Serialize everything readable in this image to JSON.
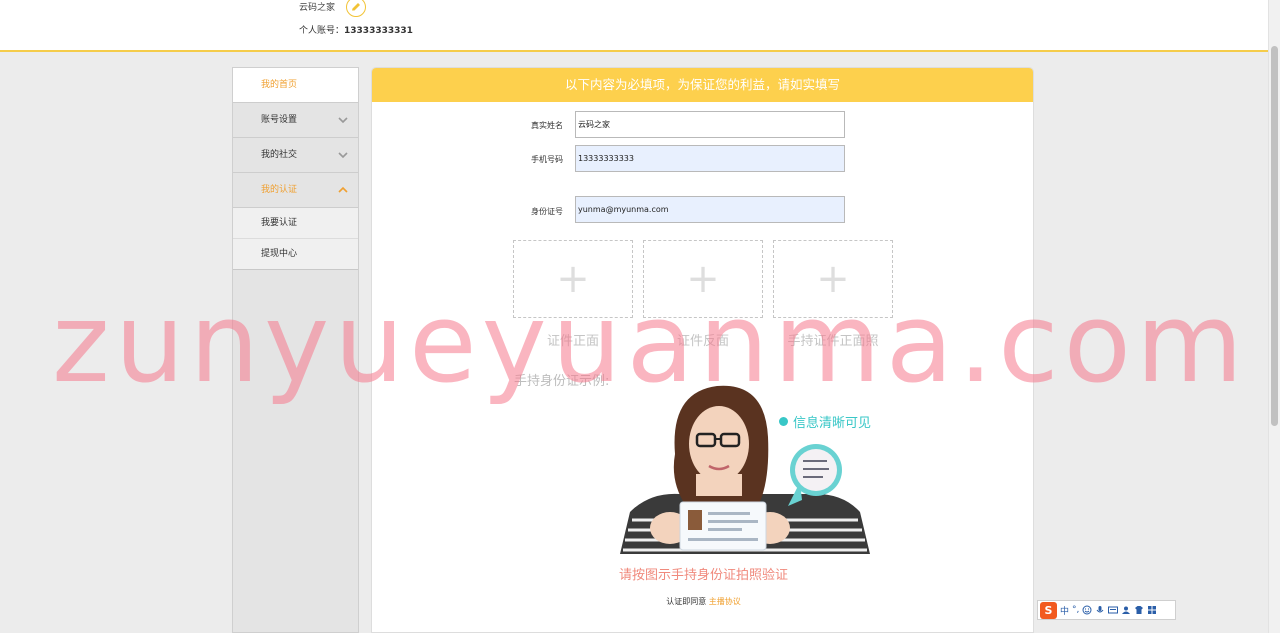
{
  "header": {
    "nickname": "云码之家",
    "account_label": "个人账号：",
    "account_value": "13333333331"
  },
  "sidebar": {
    "home": "我的首页",
    "items": [
      {
        "label": "账号设置"
      },
      {
        "label": "我的社交"
      },
      {
        "label": "我的认证"
      }
    ],
    "sub_items": [
      {
        "label": "我要认证"
      },
      {
        "label": "提现中心"
      }
    ]
  },
  "panel": {
    "notice": "以下内容为必填项，为保证您的利益，请如实填写",
    "fields": [
      {
        "label": "真实姓名",
        "value": "云码之家"
      },
      {
        "label": "手机号码",
        "value": "13333333333"
      },
      {
        "label": "身份证号",
        "value": "yunma@myunma.com"
      }
    ],
    "uploads": [
      {
        "label": "证件正面"
      },
      {
        "label": "证件反面"
      },
      {
        "label": "手持证件正面照"
      }
    ],
    "example_label": "手持身份证示例:",
    "info_clear": "信息清晰可见",
    "verify_tip": "请按图示手持身份证拍照验证",
    "agree_text": "认证即同意",
    "agree_link": "主播协议"
  },
  "watermark": "zunyueyuanma.com",
  "ime": {
    "logo": "S",
    "lang": "中",
    "punct": "°,"
  },
  "colors": {
    "accent": "#fdd04d",
    "highlight": "#f0a030",
    "teal": "#38c7c7",
    "tip": "#f08a7d"
  }
}
